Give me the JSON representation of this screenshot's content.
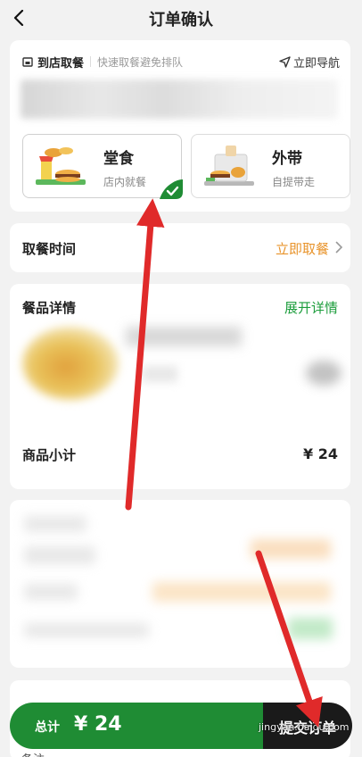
{
  "header": {
    "title": "订单确认"
  },
  "pickup": {
    "label": "到店取餐",
    "subtitle": "快速取餐避免排队",
    "nav_label": "立即导航"
  },
  "options": [
    {
      "title": "堂食",
      "subtitle": "店内就餐",
      "selected": true
    },
    {
      "title": "外带",
      "subtitle": "自提带走",
      "selected": false
    }
  ],
  "time": {
    "label": "取餐时间",
    "value": "立即取餐"
  },
  "details": {
    "label": "餐品详情",
    "expand": "展开详情",
    "subtotal_label": "商品小计",
    "subtotal_value": "¥ 24"
  },
  "footer": {
    "total_label": "总计",
    "total_value": "¥ 24",
    "submit_label": "提交订单",
    "remark_label": "备注"
  },
  "watermark": "jingyan.baidu.com",
  "colors": {
    "brand_green": "#1f8c34",
    "accent_orange": "#e8932a",
    "link_green": "#1c9d3c",
    "arrow_red": "#e02a2a"
  }
}
